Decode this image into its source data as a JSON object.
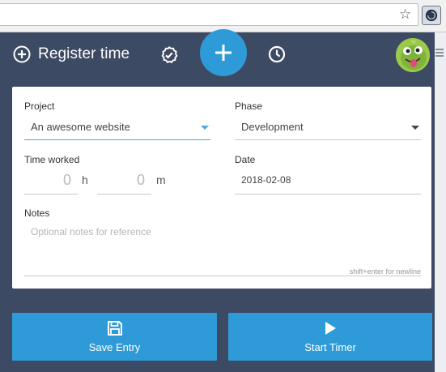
{
  "browser": {
    "star_icon": "star-icon",
    "extension_icon": "extension-clock-icon"
  },
  "header": {
    "title": "Register time",
    "add_icon": "plus-icon",
    "check_icon": "check-badge-icon",
    "clock_icon": "clock-icon",
    "accent": "#2e9bd8",
    "background": "#3d4a63"
  },
  "form": {
    "project": {
      "label": "Project",
      "value": "An awesome website"
    },
    "phase": {
      "label": "Phase",
      "value": "Development"
    },
    "time_worked": {
      "label": "Time worked",
      "hours": "0",
      "hours_unit": "h",
      "minutes": "0",
      "minutes_unit": "m"
    },
    "date": {
      "label": "Date",
      "value": "2018-02-08"
    },
    "notes": {
      "label": "Notes",
      "placeholder": "Optional notes for reference",
      "hint": "shift+enter for newline"
    }
  },
  "actions": {
    "save_label": "Save Entry",
    "save_icon": "floppy-disk-icon",
    "start_label": "Start Timer",
    "start_icon": "play-icon"
  }
}
